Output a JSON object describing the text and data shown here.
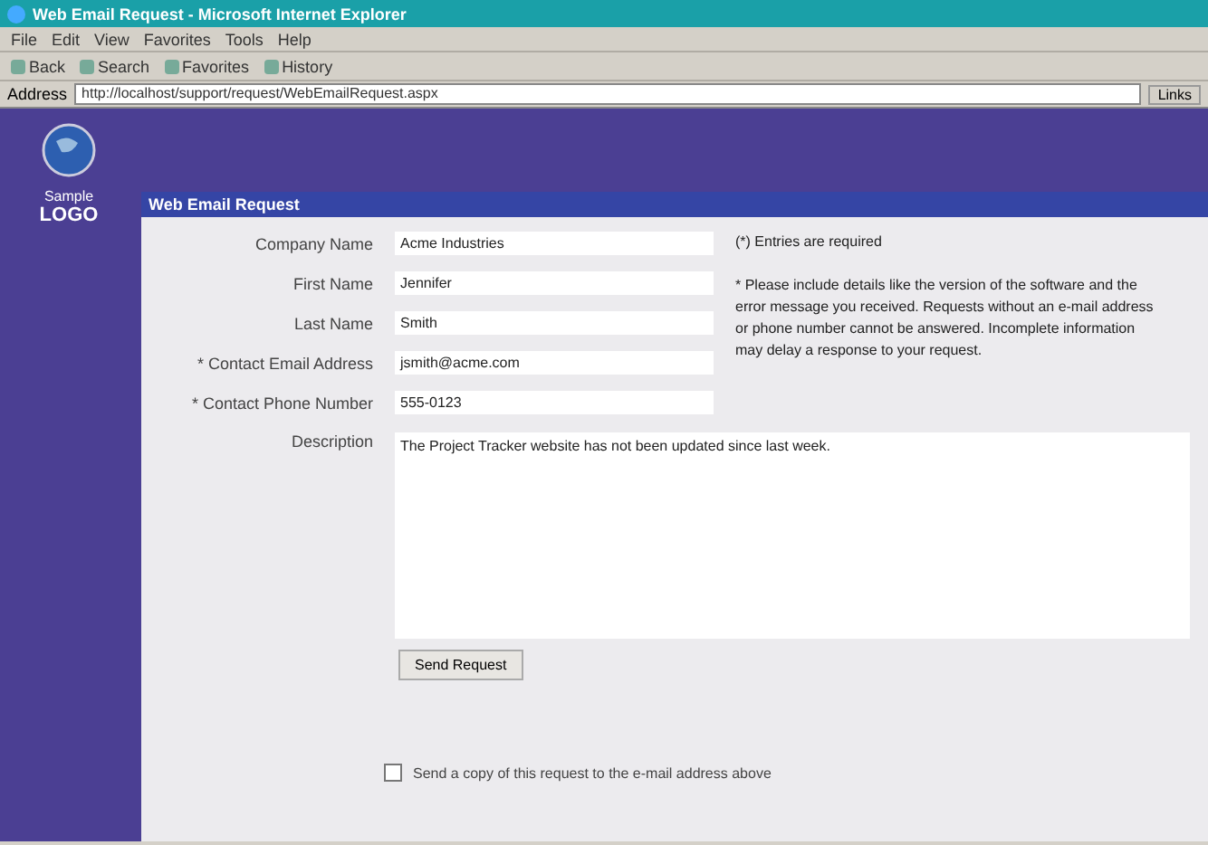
{
  "window": {
    "title": "Web Email Request - Microsoft Internet Explorer"
  },
  "menu": [
    "File",
    "Edit",
    "View",
    "Favorites",
    "Tools",
    "Help"
  ],
  "toolbar": [
    "Back",
    "Search",
    "Favorites",
    "History"
  ],
  "address": {
    "label": "Address",
    "value": "http://localhost/support/request/WebEmailRequest.aspx",
    "go": "Links"
  },
  "logo": {
    "line1": "Sample",
    "line2": "LOGO"
  },
  "form": {
    "title": "Web Email Request",
    "fields": [
      {
        "label": "Company Name",
        "value": "Acme Industries"
      },
      {
        "label": "First Name",
        "value": "Jennifer"
      },
      {
        "label": "Last Name",
        "value": "Smith"
      },
      {
        "label": "* Contact Email Address",
        "value": "jsmith@acme.com"
      },
      {
        "label": "* Contact Phone Number",
        "value": "555-0123"
      }
    ],
    "required_note": "(*) Entries are required",
    "help_note": "* Please include details like the version of the software and the error message you received. Requests without an e-mail address or phone number cannot be answered. Incomplete information may delay a response to your request.",
    "description": {
      "label": "Description",
      "value": "The Project Tracker website has not been updated since last week."
    },
    "submit": "Send Request",
    "copy": {
      "label": "Send a copy of this request to the e-mail address above",
      "checked": false
    }
  }
}
